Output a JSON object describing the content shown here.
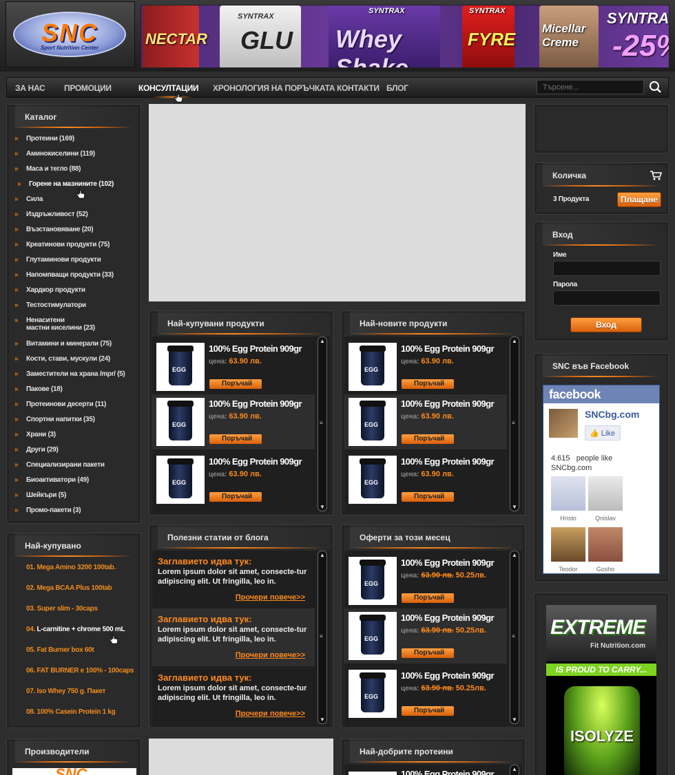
{
  "header": {
    "logo_main": "SNC",
    "logo_sub": "Sport Nutrition Center",
    "banner": {
      "brand": "SYNTRAX",
      "products": [
        "NECTAR",
        "GLU",
        "Whey Shake",
        "FYRE",
        "Micellar Creme"
      ],
      "discount": "-25%"
    }
  },
  "nav": {
    "items": [
      "ЗА НАС",
      "ПРОМОЦИИ",
      "КОНСУЛТАЦИИ",
      "ХРОНОЛОГИЯ НА ПОРЪЧКАТА",
      "КОНТАКТИ",
      "БЛОГ"
    ],
    "active": "КОНСУЛТАЦИИ",
    "search_placeholder": "Търсене..."
  },
  "catalog": {
    "title": "Каталог",
    "items": [
      "Протеини (169)",
      "Аминокиселини (119)",
      "Маса и тегло (88)",
      "Горене на мазнините (102)",
      "Сила",
      "Издръжливост (52)",
      "Възстановяване (20)",
      "Креатинови продукти (75)",
      "Глутаминови продукти",
      "Напомпващи продукти (33)",
      "Хардкор продукти",
      "Тестостимулатори",
      "Ненаситени",
      "мастни киселини (23)",
      "Витамини и минерали (75)",
      "Кости, стави, мускули (24)",
      "Заместители на храна /mpr/ (5)",
      "Пакове (18)",
      "Протеинови десерти (11)",
      "Спортни напитки (35)",
      "Храни (3)",
      "Други (29)",
      "Специализирани пакети",
      "Биоактиватори (49)",
      "Шейкъри (5)",
      "Промо-пакети (3)"
    ]
  },
  "top_sold": {
    "title": "Най-купувано",
    "items": [
      {
        "num": "01.",
        "name": "Mega Amino 3200 100tab."
      },
      {
        "num": "02.",
        "name": "Mega BCAA Plus 100tab"
      },
      {
        "num": "03.",
        "name": "Super slim - 30caps"
      },
      {
        "num": "04.",
        "name": "L-carnitine + chrome 500 mL"
      },
      {
        "num": "05.",
        "name": "Fat Burner box 60t"
      },
      {
        "num": "06.",
        "name": "FAT BURNER e 100% - 100caps"
      },
      {
        "num": "07.",
        "name": "Iso Whey 750 g. Пакет"
      },
      {
        "num": "08.",
        "name": "100% Casein Protein 1 kg"
      }
    ]
  },
  "manufacturers": {
    "title": "Производители",
    "logo": "SNC"
  },
  "best_sellers": {
    "title": "Най-купувани продукти",
    "products": [
      {
        "name": "100% Egg Protein 909gr",
        "price_label": "цена:",
        "price": "63.90 лв.",
        "order": "Поръчай"
      },
      {
        "name": "100% Egg Protein 909gr",
        "price_label": "цена:",
        "price": "63.90 лв.",
        "order": "Поръчай"
      },
      {
        "name": "100% Egg Protein 909gr",
        "price_label": "цена:",
        "price": "63.90 лв.",
        "order": "Поръчай"
      }
    ]
  },
  "newest": {
    "title": "Най-новите продукти",
    "products": [
      {
        "name": "100% Egg Protein 909gr",
        "price_label": "цена:",
        "price": "63.90 лв.",
        "order": "Поръчай"
      },
      {
        "name": "100% Egg Protein 909gr",
        "price_label": "цена:",
        "price": "63.90 лв.",
        "order": "Поръчай"
      },
      {
        "name": "100% Egg Protein 909gr",
        "price_label": "цена:",
        "price": "63.90 лв.",
        "order": "Поръчай"
      }
    ]
  },
  "blog": {
    "title": "Полезни статии от блога",
    "posts": [
      {
        "title": "Заглавието идва тук:",
        "text": "Lorem ipsum dolor sit amet, consecte-tur adipiscing elit. Ut fringilla, leo in.",
        "more": "Прочери повече>>"
      },
      {
        "title": "Заглавието идва тук:",
        "text": "Lorem ipsum dolor sit amet, consecte-tur adipiscing elit. Ut fringilla, leo in.",
        "more": "Прочери повече>>"
      },
      {
        "title": "Заглавието идва тук:",
        "text": "Lorem ipsum dolor sit amet, consecte-tur adipiscing elit. Ut fringilla, leo in.",
        "more": "Прочери повече>>"
      }
    ]
  },
  "offers": {
    "title": "Оферти за този месец",
    "products": [
      {
        "name": "100% Egg Protein 909gr",
        "price_label": "цена:",
        "old_price": "63.90 лв.",
        "new_price": "50.25лв.",
        "order": "Поръчай"
      },
      {
        "name": "100% Egg Protein 909gr",
        "price_label": "цена:",
        "old_price": "63.90 лв.",
        "new_price": "50.25лв.",
        "order": "Поръчай"
      },
      {
        "name": "100% Egg Protein 909gr",
        "price_label": "цена:",
        "old_price": "63.90 лв.",
        "new_price": "50.25лв.",
        "order": "Поръчай"
      }
    ]
  },
  "best_proteins": {
    "title": "Най-добрите протеини",
    "first_product": "100% Egg Protein 909gr"
  },
  "cart": {
    "title": "Количка",
    "count": "3 Продукта",
    "checkout": "Плащане"
  },
  "login": {
    "title": "Вход",
    "name_label": "Име",
    "password_label": "Парола",
    "button": "Вход"
  },
  "facebook": {
    "title": "SNC във Facebook",
    "brand": "facebook",
    "page_name": "SNCbg.com",
    "like": "Like",
    "count": "4.615",
    "people_like": "people like",
    "page_ref": "SNCbg.com",
    "fans": [
      "Hristo",
      "Qnislav",
      "Teodor",
      "Gosho"
    ]
  },
  "ad": {
    "brand": "EXTREME",
    "sub": "Fit Nutrition.com",
    "tag": "IS PROUD TO CARRY...",
    "product": "ISOLYZE"
  }
}
